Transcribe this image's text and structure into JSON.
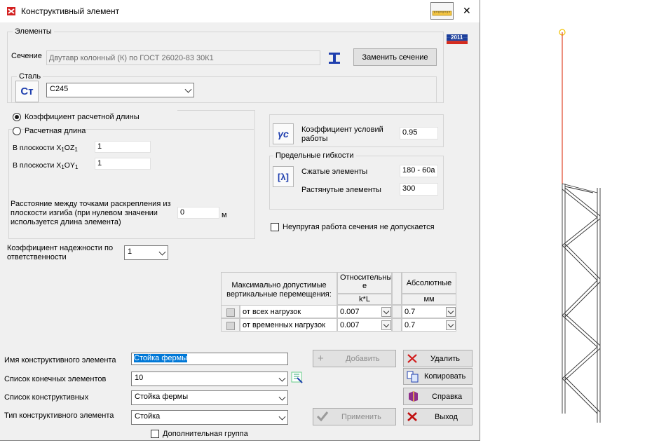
{
  "window": {
    "title": "Конструктивный элемент",
    "close_glyph": "✕",
    "flag_label": "2011"
  },
  "elements_group": {
    "label": "Элементы",
    "section_label": "Сечение",
    "section_value": "Двутавр колонный (К) по ГОСТ 26020-83  30К1",
    "replace_button": "Заменить сечение",
    "steel_label": "Сталь",
    "steel_icon_text": "Cт",
    "steel_value": "С245"
  },
  "length_group": {
    "radio_coef": "Коэффициент расчетной длины",
    "radio_length": "Расчетная длина",
    "plane_xoz_prefix": "В плоскости X",
    "plane_xoz_mid": "OZ",
    "plane_xoz_sub": "1",
    "plane_xoz_value": "1",
    "plane_xoy_prefix": "В плоскости X",
    "plane_xoy_mid": "OY",
    "plane_xoy_sub": "1",
    "plane_xoy_value": "1",
    "distance_label_1": "Расстояние между точками раскрепления из",
    "distance_label_2": "плоскости изгиба (при нулевом значении",
    "distance_label_3": "используется длина элемента)",
    "distance_value": "0",
    "distance_unit": "м"
  },
  "reliability": {
    "label_1": "Коэффициент надежности по",
    "label_2": "ответственности",
    "value": "1"
  },
  "work_conditions": {
    "icon_text": "γc",
    "label_1": "Коэффициент условий",
    "label_2": "работы",
    "value": "0.95"
  },
  "slenderness": {
    "label": "Предельные гибкости",
    "icon_text": "[λ]",
    "compressed_label": "Сжатые элементы",
    "compressed_value": "180 - 60a",
    "tension_label": "Растянутые элементы",
    "tension_value": "300"
  },
  "inelastic_checkbox": "Неупругая работа сечения не допускается",
  "displacements": {
    "header_1": "Максимально допустимые",
    "header_2": "вертикальные перемещения:",
    "rel_header_1": "Относительны",
    "rel_header_2": "е",
    "rel_unit": "k*L",
    "abs_header": "Абсолютные",
    "abs_unit": "мм",
    "rows": [
      {
        "label": "от всех нагрузок",
        "relative": "0.007",
        "absolute": "0.7"
      },
      {
        "label": "от временных нагрузок",
        "relative": "0.007",
        "absolute": "0.7"
      }
    ]
  },
  "bottom": {
    "name_label": "Имя конструктивного элемента",
    "name_value": "Стойка фермы",
    "fe_list_label": "Список конечных элементов",
    "fe_list_value": "10",
    "ce_list_label": "Список конструктивных",
    "ce_list_value": "Стойка фермы",
    "type_label": "Тип конструктивного элемента",
    "type_value": "Стойка",
    "extra_group": "Дополнительная группа"
  },
  "buttons": {
    "add": "Добавить",
    "apply": "Применить",
    "delete": "Удалить",
    "copy": "Копировать",
    "help": "Справка",
    "exit": "Выход"
  },
  "colors": {
    "dialog_bg": "#f0f0f0",
    "selection": "#0078d7",
    "icon_blue": "#1f3fae",
    "red_x": "#d11a1a",
    "highlight_red": "#e0452a"
  }
}
